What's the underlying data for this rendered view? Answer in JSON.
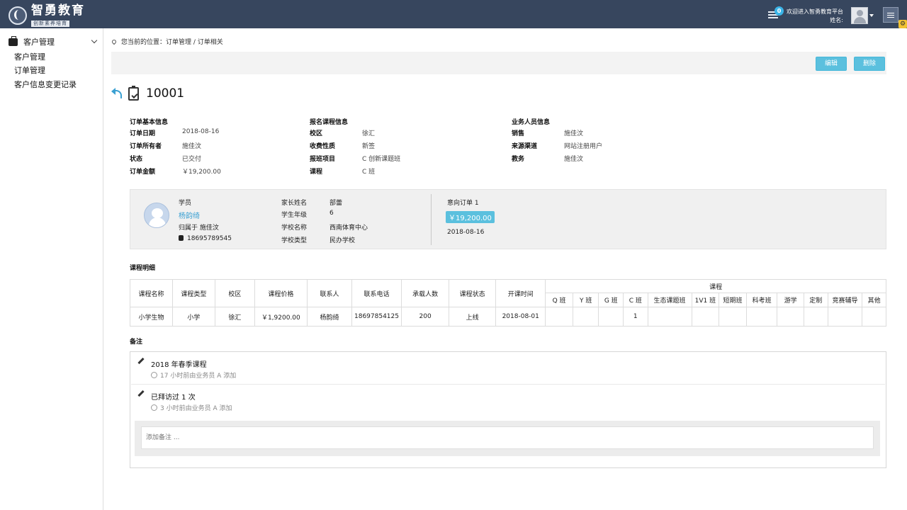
{
  "app": {
    "logo_title": "智勇教育",
    "logo_subtitle": "创新素养培育",
    "notification_count": "0",
    "welcome_line1": "欢迎进入智勇教育平台",
    "welcome_line2": "姓名:"
  },
  "sidebar": {
    "group_label": "客户管理",
    "items": [
      {
        "label": "客户管理"
      },
      {
        "label": "订单管理"
      },
      {
        "label": "客户信息变更记录"
      }
    ]
  },
  "breadcrumb": "您当前的位置：订单管理 / 订单相关",
  "toolbar": {
    "edit_label": "编辑",
    "delete_label": "删除"
  },
  "order": {
    "number": "10001",
    "basic": {
      "title": "订单基本信息",
      "rows": [
        {
          "k": "订单日期",
          "v": "2018-08-16"
        },
        {
          "k": "订单所有者",
          "v": "施佳汶"
        },
        {
          "k": "状态",
          "v": "已交付"
        },
        {
          "k": "订单金额",
          "v": "￥19,200.00"
        }
      ]
    },
    "course": {
      "title": "报名课程信息",
      "rows": [
        {
          "k": "校区",
          "v": "徐汇"
        },
        {
          "k": "收费性质",
          "v": "新签"
        },
        {
          "k": "报班项目",
          "v": "C 创新课题班"
        },
        {
          "k": "课程",
          "v": "C 班"
        }
      ]
    },
    "staff": {
      "title": "业务人员信息",
      "rows": [
        {
          "k": "销售",
          "v": "施佳汶"
        },
        {
          "k": "来源渠道",
          "v": "网站注册用户"
        },
        {
          "k": "教务",
          "v": "施佳汶"
        }
      ]
    }
  },
  "student_card": {
    "label": "学员",
    "name": "杨韵绮",
    "owner": "归属于 施佳汶",
    "phone": "18695789545",
    "details": [
      {
        "k": "家长姓名",
        "v": "部蕾"
      },
      {
        "k": "学生年级",
        "v": "6"
      },
      {
        "k": "学校名称",
        "v": "西南体育中心"
      },
      {
        "k": "学校类型",
        "v": "民办学校"
      }
    ],
    "intent_label": "意向订单 1",
    "intent_price": "￥19,200.00",
    "intent_date": "2018-08-16"
  },
  "course_table": {
    "title": "课程明细",
    "headers": [
      "课程名称",
      "课程类型",
      "校区",
      "课程价格",
      "联系人",
      "联系电话",
      "承载人数",
      "课程状态",
      "开课时间"
    ],
    "group_header": "课程",
    "sub_headers": [
      "Q 班",
      "Y 班",
      "G 班",
      "C 班",
      "生态课题班",
      "1V1 班",
      "短期班",
      "科考班",
      "游学",
      "定制",
      "竞赛辅导",
      "其他"
    ],
    "row": [
      "小学生物",
      "小学",
      "徐汇",
      "￥1,9200.00",
      "杨韵绮",
      "18697854125",
      "200",
      "上线",
      "2018-08-01"
    ],
    "row_sub": [
      "",
      "",
      "",
      "1",
      "",
      "",
      "",
      "",
      "",
      "",
      "",
      ""
    ]
  },
  "notes": {
    "title": "备注",
    "items": [
      {
        "text": "2018 年春季课程",
        "meta": "17 小时前由业务员 A 添加"
      },
      {
        "text": "已拜访过 1 次",
        "meta": "3 小时前由业务员 A 添加"
      }
    ],
    "placeholder": "添加备注 ..."
  }
}
